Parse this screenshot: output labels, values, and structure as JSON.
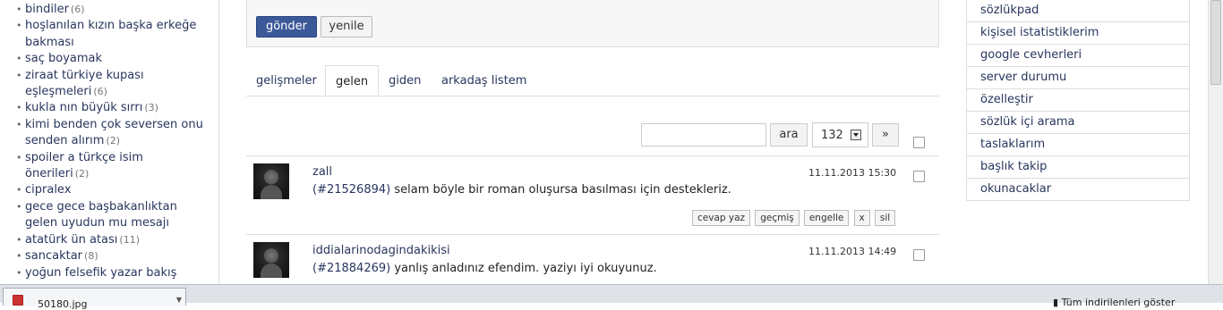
{
  "left_sidebar": {
    "items": [
      {
        "label": "bindiler",
        "count": "(6)"
      },
      {
        "label": "hoşlanılan kızın başka erkeğe bakması",
        "count": ""
      },
      {
        "label": "saç boyamak",
        "count": ""
      },
      {
        "label": "ziraat türkiye kupası eşleşmeleri",
        "count": "(6)"
      },
      {
        "label": "kukla nın büyük sırrı",
        "count": "(3)"
      },
      {
        "label": "kimi benden çok seversen onu senden alırım",
        "count": "(2)"
      },
      {
        "label": "spoiler a türkçe isim önerileri",
        "count": "(2)"
      },
      {
        "label": "cipralex",
        "count": ""
      },
      {
        "label": "gece gece başbakanlıktan gelen uyudun mu mesajı",
        "count": ""
      },
      {
        "label": "atatürk ün atası",
        "count": "(11)"
      },
      {
        "label": "sancaktar",
        "count": "(8)"
      },
      {
        "label": "yoğun felsefik yazar bakış",
        "count": ""
      }
    ]
  },
  "composer": {
    "send_label": "gönder",
    "refresh_label": "yenile"
  },
  "tabs": [
    {
      "label": "gelişmeler",
      "active": false
    },
    {
      "label": "gelen",
      "active": true
    },
    {
      "label": "giden",
      "active": false
    },
    {
      "label": "arkadaş listem",
      "active": false
    }
  ],
  "toolbar": {
    "search_value": "",
    "search_button": "ara",
    "page_value": "132",
    "next_label": "»"
  },
  "messages": [
    {
      "author": "zall",
      "date": "11.11.2013 15:30",
      "ref": "(#21526894)",
      "text": "selam böyle bir roman oluşursa basılması için destekleriz.",
      "actions": [
        "cevap yaz",
        "geçmiş",
        "engelle",
        "x",
        "sil"
      ]
    },
    {
      "author": "iddialarinodagindakikisi",
      "date": "11.11.2013 14:49",
      "ref": "(#21884269)",
      "text": "yanlış anladınız efendim. yaziyı iyi okuyunuz.",
      "actions": []
    }
  ],
  "right_sidebar": {
    "items": [
      "sözlükpad",
      "kişisel istatistiklerim",
      "google cevherleri",
      "server durumu",
      "özelleştir",
      "sözlük içi arama",
      "taslaklarım",
      "başlık takip",
      "okunacaklar"
    ]
  },
  "download_bar": {
    "file_name": "50180.jpg",
    "show_all": "Tüm indirilenleri göster"
  },
  "colors": {
    "link": "#29365e",
    "primary_button": "#3b5998"
  }
}
